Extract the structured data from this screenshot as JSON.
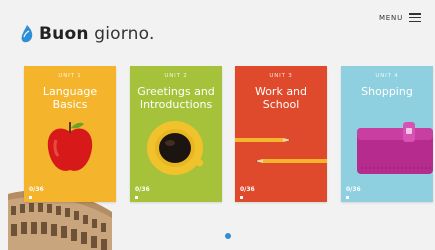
{
  "header": {
    "brand_bold": "Buon",
    "brand_light": "giorno.",
    "menu_label": "MENU"
  },
  "units": [
    {
      "unit": "UNIT 1",
      "title_line1": "Language",
      "title_line2": "Basics",
      "progress": "0/36",
      "color": "#f4b52c",
      "illustration": "apple-icon"
    },
    {
      "unit": "UNIT 2",
      "title_line1": "Greetings and",
      "title_line2": "Introductions",
      "progress": "0/36",
      "color": "#a5c23a",
      "illustration": "coffee-cup-icon"
    },
    {
      "unit": "UNIT 3",
      "title_line1": "Work and",
      "title_line2": "School",
      "progress": "0/36",
      "color": "#e04a2c",
      "illustration": "pencils-icon"
    },
    {
      "unit": "UNIT 4",
      "title_line1": "Shopping",
      "title_line2": "",
      "progress": "0/36",
      "color": "#8ecfe0",
      "illustration": "wallet-icon"
    }
  ],
  "carousel": {
    "active_page": 1
  },
  "colors": {
    "accent": "#2e8fd6",
    "background": "#f2f2f2"
  }
}
